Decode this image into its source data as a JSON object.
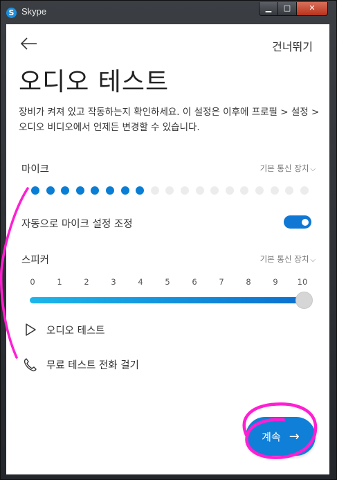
{
  "window": {
    "app_title": "Skype",
    "logo_letter": "S",
    "caption": {
      "minimize": "▁",
      "maximize": "□",
      "close": "✕"
    }
  },
  "header": {
    "back_icon": "back-arrow-icon",
    "skip_label": "건너뛰기"
  },
  "page": {
    "title": "오디오 테스트",
    "description": "장비가 켜져 있고 작동하는지 확인하세요. 이 설정은 이후에 프로필 > 설정 > 오디오 비디오에서 언제든 변경할 수 있습니다."
  },
  "microphone": {
    "label": "마이크",
    "device": "기본 통신 장치",
    "level_dots_total": 19,
    "level_dots_active": 8,
    "auto_adjust_label": "자동으로 마이크 설정 조정",
    "auto_adjust_on": true
  },
  "speaker": {
    "label": "스피커",
    "device": "기본 통신 장치",
    "scale": [
      "0",
      "1",
      "2",
      "3",
      "4",
      "5",
      "6",
      "7",
      "8",
      "9",
      "10"
    ],
    "volume": 10
  },
  "actions": {
    "audio_test_label": "오디오 테스트",
    "test_call_label": "무료 테스트 전화 걸기"
  },
  "footer": {
    "continue_label": "계속"
  },
  "colors": {
    "accent": "#0f7fd8",
    "meter_active": "#0a7dd4",
    "meter_inactive": "#ececec",
    "annotation": "#ff1fd2"
  }
}
